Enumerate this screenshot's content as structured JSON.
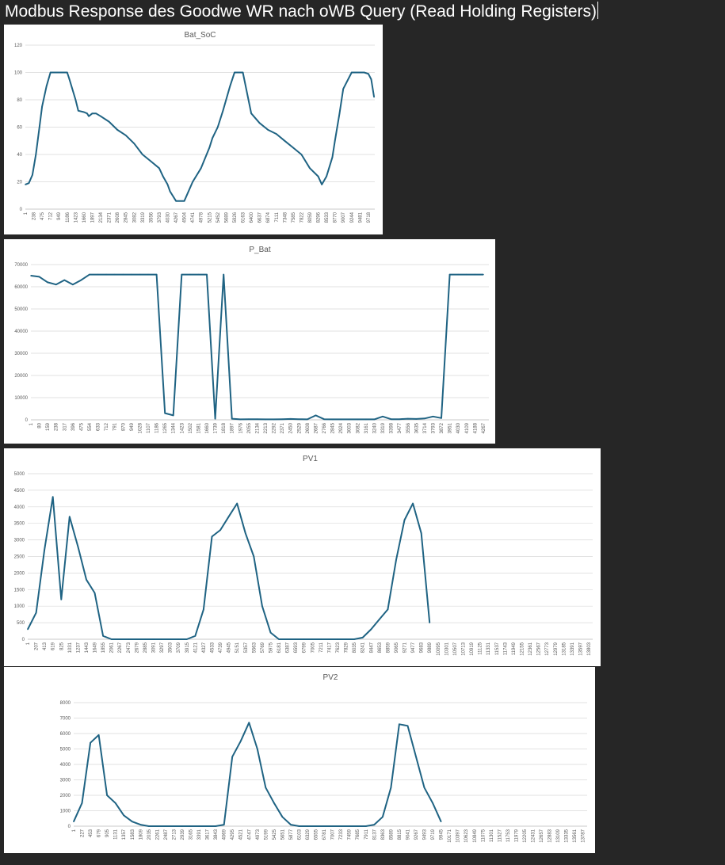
{
  "header": {
    "title": "Modbus Response des Goodwe WR nach oWB Query (Read Holding Registers)"
  },
  "colors": {
    "series": "#1f6383",
    "background": "#262626",
    "panel": "#ffffff",
    "grid": "#d9d9d9",
    "text": "#595959"
  },
  "chart_data": [
    {
      "type": "line",
      "title": "Bat_SoC",
      "ylim": [
        0,
        120
      ],
      "yticks": [
        0,
        20,
        40,
        60,
        80,
        100,
        120
      ],
      "xlim": [
        1,
        9900
      ],
      "xticks": [
        1,
        238,
        475,
        712,
        949,
        1186,
        1423,
        1660,
        1897,
        2134,
        2371,
        2608,
        2845,
        3082,
        3319,
        3556,
        3793,
        4030,
        4267,
        4504,
        4741,
        4978,
        5215,
        5452,
        5689,
        5926,
        6163,
        6400,
        6637,
        6874,
        7111,
        7348,
        7585,
        7822,
        8059,
        8296,
        8533,
        8770,
        9007,
        9244,
        9481,
        9718
      ],
      "series": [
        {
          "x": [
            1,
            100,
            200,
            300,
            400,
            475,
            600,
            712,
            900,
            1050,
            1100,
            1186,
            1250,
            1423,
            1500,
            1660,
            1750,
            1800,
            1897,
            2000,
            2134,
            2371,
            2608,
            2845,
            3082,
            3319,
            3556,
            3793,
            3900,
            4030,
            4100,
            4267,
            4504,
            4741,
            4978,
            5215,
            5300,
            5452,
            5600,
            5800,
            5926,
            6000,
            6163,
            6400,
            6637,
            6874,
            7111,
            7348,
            7585,
            7822,
            8059,
            8296,
            8400,
            8533,
            8700,
            8770,
            8900,
            9007,
            9244,
            9481,
            9600,
            9718,
            9800,
            9880
          ],
          "y": [
            18,
            19,
            25,
            40,
            60,
            75,
            90,
            100,
            100,
            100,
            100,
            100,
            95,
            80,
            72,
            71,
            70,
            68,
            70,
            70,
            68,
            64,
            58,
            54,
            48,
            40,
            35,
            30,
            24,
            18,
            13,
            6,
            6,
            20,
            30,
            45,
            52,
            60,
            72,
            90,
            100,
            100,
            100,
            70,
            63,
            58,
            55,
            50,
            45,
            40,
            30,
            24,
            18,
            24,
            38,
            50,
            70,
            88,
            100,
            100,
            100,
            99,
            95,
            82
          ]
        }
      ]
    },
    {
      "type": "line",
      "title": "P_Bat",
      "ylim": [
        0,
        70000
      ],
      "yticks": [
        0,
        10000,
        20000,
        30000,
        40000,
        50000,
        60000,
        70000
      ],
      "xlim": [
        1,
        4320
      ],
      "xticks": [
        1,
        80,
        159,
        238,
        317,
        396,
        475,
        554,
        633,
        712,
        791,
        870,
        949,
        1028,
        1107,
        1186,
        1265,
        1344,
        1423,
        1502,
        1581,
        1660,
        1739,
        1818,
        1897,
        1976,
        2055,
        2134,
        2213,
        2292,
        2371,
        2450,
        2529,
        2608,
        2687,
        2766,
        2845,
        2924,
        3003,
        3082,
        3161,
        3240,
        3319,
        3398,
        3477,
        3556,
        3635,
        3714,
        3793,
        3872,
        3951,
        4030,
        4109,
        4188,
        4267
      ],
      "series": [
        {
          "x": [
            1,
            80,
            159,
            238,
            317,
            396,
            475,
            554,
            633,
            712,
            791,
            870,
            949,
            1028,
            1107,
            1186,
            1265,
            1344,
            1423,
            1502,
            1581,
            1660,
            1739,
            1818,
            1897,
            1976,
            2055,
            2134,
            2213,
            2292,
            2371,
            2450,
            2529,
            2608,
            2687,
            2766,
            2845,
            2924,
            3003,
            3082,
            3161,
            3240,
            3319,
            3398,
            3477,
            3556,
            3635,
            3714,
            3793,
            3872,
            3951,
            4030,
            4109,
            4188,
            4267
          ],
          "y": [
            65000,
            64500,
            62000,
            61000,
            63000,
            61000,
            63000,
            65500,
            65500,
            65500,
            65500,
            65500,
            65500,
            65500,
            65500,
            65500,
            3000,
            2000,
            65500,
            65500,
            65500,
            65500,
            500,
            65500,
            500,
            200,
            300,
            300,
            200,
            200,
            300,
            400,
            300,
            200,
            2000,
            300,
            200,
            200,
            200,
            200,
            200,
            200,
            1500,
            300,
            300,
            500,
            400,
            600,
            1500,
            800,
            65500,
            65500,
            65500,
            65500,
            65500
          ]
        }
      ]
    },
    {
      "type": "line",
      "title": "PV1",
      "ylim": [
        0,
        5000
      ],
      "yticks": [
        0,
        500,
        1000,
        1500,
        2000,
        2500,
        3000,
        3500,
        4000,
        4500,
        5000
      ],
      "xlim": [
        1,
        13900
      ],
      "xticks": [
        1,
        207,
        413,
        619,
        825,
        1031,
        1237,
        1443,
        1649,
        1855,
        2061,
        2267,
        2473,
        2679,
        2885,
        3091,
        3297,
        3503,
        3709,
        3915,
        4121,
        4327,
        4533,
        4739,
        4945,
        5151,
        5357,
        5563,
        5769,
        5975,
        6181,
        6387,
        6593,
        6799,
        7005,
        7211,
        7417,
        7623,
        7829,
        8035,
        8241,
        8447,
        8653,
        8859,
        9065,
        9271,
        9477,
        9683,
        9889,
        10095,
        10301,
        10507,
        10713,
        10919,
        11125,
        11331,
        11537,
        11743,
        11949,
        12155,
        12361,
        12567,
        12773,
        12979,
        13185,
        13391,
        13597,
        13803
      ],
      "series": [
        {
          "x": [
            1,
            207,
            413,
            619,
            825,
            1031,
            1237,
            1443,
            1649,
            1855,
            2061,
            2267,
            2473,
            2679,
            2885,
            3091,
            3297,
            3503,
            3709,
            3915,
            4121,
            4327,
            4533,
            4739,
            4945,
            5151,
            5357,
            5563,
            5769,
            5975,
            6181,
            6387,
            6593,
            6799,
            7005,
            7211,
            7417,
            7623,
            7829,
            8035,
            8241,
            8447,
            8653,
            8859,
            9065,
            9271,
            9477,
            9683,
            9889
          ],
          "y": [
            300,
            800,
            2700,
            4300,
            1200,
            3700,
            2800,
            1800,
            1400,
            100,
            0,
            0,
            0,
            0,
            0,
            0,
            0,
            0,
            0,
            0,
            100,
            900,
            3100,
            3300,
            3700,
            4100,
            3200,
            2500,
            1000,
            200,
            0,
            0,
            0,
            0,
            0,
            0,
            0,
            0,
            0,
            0,
            50,
            300,
            600,
            900,
            2400,
            3600,
            4100,
            3200,
            500
          ]
        }
      ]
    },
    {
      "type": "line",
      "title": "PV2",
      "ylim": [
        0,
        8000
      ],
      "yticks": [
        0,
        1000,
        2000,
        3000,
        4000,
        5000,
        6000,
        7000,
        8000
      ],
      "xlim": [
        1,
        13900
      ],
      "xticks": [
        1,
        227,
        453,
        679,
        905,
        1131,
        1357,
        1583,
        1809,
        2035,
        2261,
        2487,
        2713,
        2939,
        3165,
        3391,
        3617,
        3843,
        4069,
        4295,
        4521,
        4747,
        4973,
        5199,
        5425,
        5651,
        5877,
        6103,
        6329,
        6555,
        6781,
        7007,
        7233,
        7459,
        7685,
        7911,
        8137,
        8363,
        8589,
        8815,
        9041,
        9267,
        9493,
        9719,
        9945,
        10171,
        10397,
        10623,
        10849,
        11075,
        11301,
        11527,
        11753,
        11979,
        12205,
        12431,
        12657,
        12883,
        13109,
        13335,
        13561,
        13787
      ],
      "series": [
        {
          "x": [
            1,
            227,
            453,
            679,
            905,
            1131,
            1357,
            1583,
            1809,
            2035,
            2261,
            2487,
            2713,
            2939,
            3165,
            3391,
            3617,
            3843,
            4069,
            4295,
            4521,
            4747,
            4973,
            5199,
            5425,
            5651,
            5877,
            6103,
            6329,
            6555,
            6781,
            7007,
            7233,
            7459,
            7685,
            7911,
            8137,
            8363,
            8589,
            8815,
            9041,
            9267,
            9493,
            9719,
            9945
          ],
          "y": [
            300,
            1500,
            5400,
            5900,
            2000,
            1500,
            700,
            300,
            100,
            0,
            0,
            0,
            0,
            0,
            0,
            0,
            0,
            0,
            100,
            4500,
            5500,
            6700,
            5000,
            2500,
            1500,
            600,
            100,
            0,
            0,
            0,
            0,
            0,
            0,
            0,
            0,
            0,
            100,
            600,
            2500,
            6600,
            6500,
            4500,
            2500,
            1500,
            300
          ]
        }
      ]
    }
  ]
}
